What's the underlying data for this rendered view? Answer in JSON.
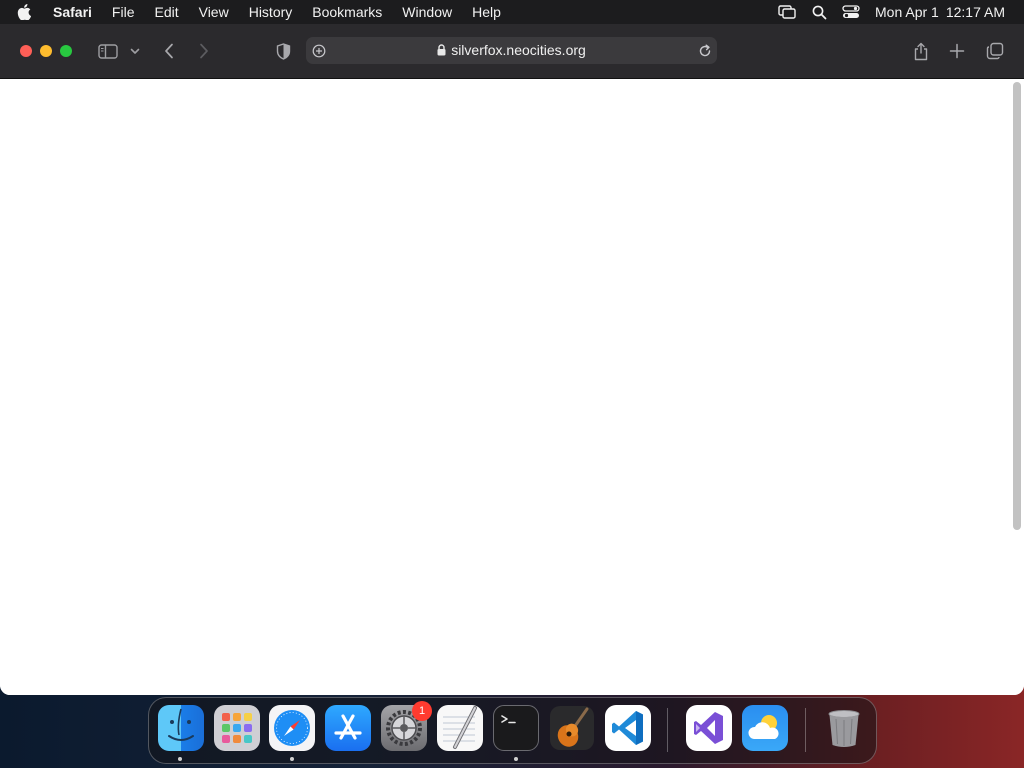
{
  "menubar": {
    "apple_icon": "apple-logo-icon",
    "items": [
      "Safari",
      "File",
      "Edit",
      "View",
      "History",
      "Bookmarks",
      "Window",
      "Help"
    ],
    "clock": {
      "date": "Mon Apr 1",
      "time": "12:17 AM"
    }
  },
  "browser": {
    "url": "silverfox.neocities.org",
    "icons": [
      "sidebar-icon",
      "chevron-down-icon",
      "back-icon",
      "forward-icon",
      "privacy-shield-icon",
      "site-settings-icon",
      "lock-icon",
      "reload-icon",
      "share-icon",
      "new-tab-icon",
      "tab-overview-icon"
    ]
  },
  "dock": {
    "apps": [
      "Finder",
      "Launchpad",
      "Safari",
      "App Store",
      "System Settings",
      "TextEdit",
      "Terminal",
      "GarageBand",
      "Visual Studio Code",
      "Visual Studio",
      "Weather",
      "Trash"
    ],
    "system_settings_badge": "1"
  }
}
